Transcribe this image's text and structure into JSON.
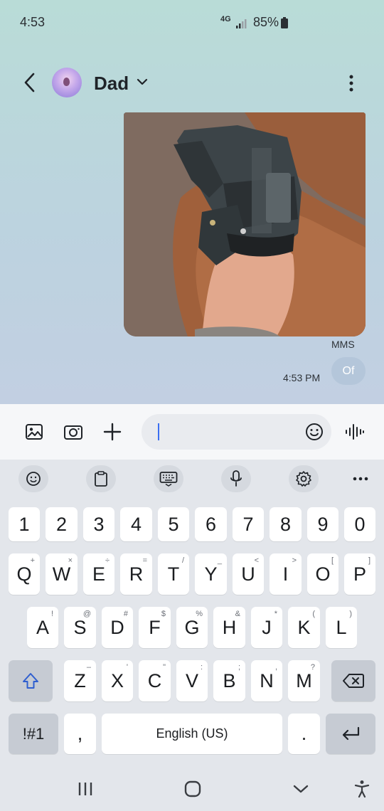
{
  "status_bar": {
    "time": "4:53",
    "network": "4G",
    "battery": "85%"
  },
  "header": {
    "contact_name": "Dad"
  },
  "conversation": {
    "attachment_type": "MMS",
    "message_time": "4:53 PM",
    "message_text": "Of"
  },
  "composer": {
    "placeholder": ""
  },
  "keyboard": {
    "number_row": [
      "1",
      "2",
      "3",
      "4",
      "5",
      "6",
      "7",
      "8",
      "9",
      "0"
    ],
    "row1": [
      {
        "label": "Q",
        "sub": "+"
      },
      {
        "label": "W",
        "sub": "×"
      },
      {
        "label": "E",
        "sub": "÷"
      },
      {
        "label": "R",
        "sub": "="
      },
      {
        "label": "T",
        "sub": "/"
      },
      {
        "label": "Y",
        "sub": "_"
      },
      {
        "label": "U",
        "sub": "<"
      },
      {
        "label": "I",
        "sub": ">"
      },
      {
        "label": "O",
        "sub": "["
      },
      {
        "label": "P",
        "sub": "]"
      }
    ],
    "row2": [
      {
        "label": "A",
        "sub": "!"
      },
      {
        "label": "S",
        "sub": "@"
      },
      {
        "label": "D",
        "sub": "#"
      },
      {
        "label": "F",
        "sub": "$"
      },
      {
        "label": "G",
        "sub": "%"
      },
      {
        "label": "H",
        "sub": "&"
      },
      {
        "label": "J",
        "sub": "*"
      },
      {
        "label": "K",
        "sub": "("
      },
      {
        "label": "L",
        "sub": ")"
      }
    ],
    "row3": [
      {
        "label": "Z",
        "sub": "–"
      },
      {
        "label": "X",
        "sub": "'"
      },
      {
        "label": "C",
        "sub": "\""
      },
      {
        "label": "V",
        "sub": ":"
      },
      {
        "label": "B",
        "sub": ";"
      },
      {
        "label": "N",
        "sub": ","
      },
      {
        "label": "M",
        "sub": "?"
      }
    ],
    "symbols_label": "!#1",
    "comma_label": ",",
    "space_label": "English (US)",
    "period_label": "."
  },
  "colors": {
    "accent_caret": "#3b6ff2",
    "key_bg": "#ffffff",
    "key_special_bg": "#c6cbd3",
    "keyboard_bg": "#e3e6eb",
    "bubble_bg": "#afc3d7"
  },
  "icons": [
    "back-arrow-icon",
    "chevron-down-icon",
    "more-vert-icon",
    "gallery-icon",
    "camera-icon",
    "plus-icon",
    "emoji-icon",
    "voice-icon",
    "sticker-icon",
    "clipboard-icon",
    "keyboard-icon",
    "mic-icon",
    "gear-icon",
    "ellipsis-icon",
    "shift-icon",
    "backspace-icon",
    "enter-icon",
    "recents-icon",
    "home-icon",
    "back-nav-icon",
    "accessibility-icon"
  ]
}
